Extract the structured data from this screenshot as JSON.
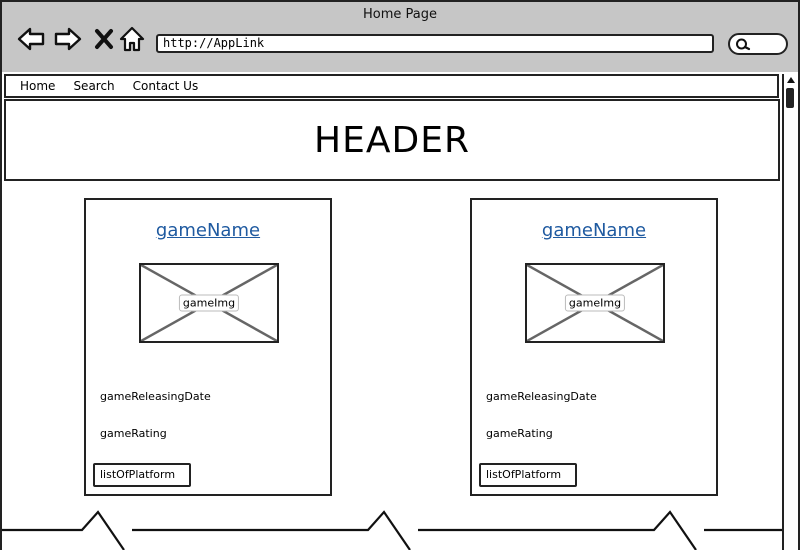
{
  "window": {
    "title": "Home Page",
    "url": "http://AppLink"
  },
  "toolbar": {
    "back_icon": "arrow-left-icon",
    "forward_icon": "arrow-right-icon",
    "stop_icon": "close-icon",
    "home_icon": "home-icon",
    "search_icon": "search-icon"
  },
  "menu": {
    "items": [
      "Home",
      "Search",
      "Contact Us"
    ]
  },
  "header": {
    "text": "HEADER"
  },
  "cards": [
    {
      "title": "gameName",
      "image_label": "gameImg",
      "release_date": "gameReleasingDate",
      "rating": "gameRating",
      "platform_button": "listOfPlatform"
    },
    {
      "title": "gameName",
      "image_label": "gameImg",
      "release_date": "gameReleasingDate",
      "rating": "gameRating",
      "platform_button": "listOfPlatform"
    }
  ],
  "colors": {
    "link": "#1f5aa0",
    "chrome": "#c6c6c6",
    "stroke": "#222222"
  }
}
